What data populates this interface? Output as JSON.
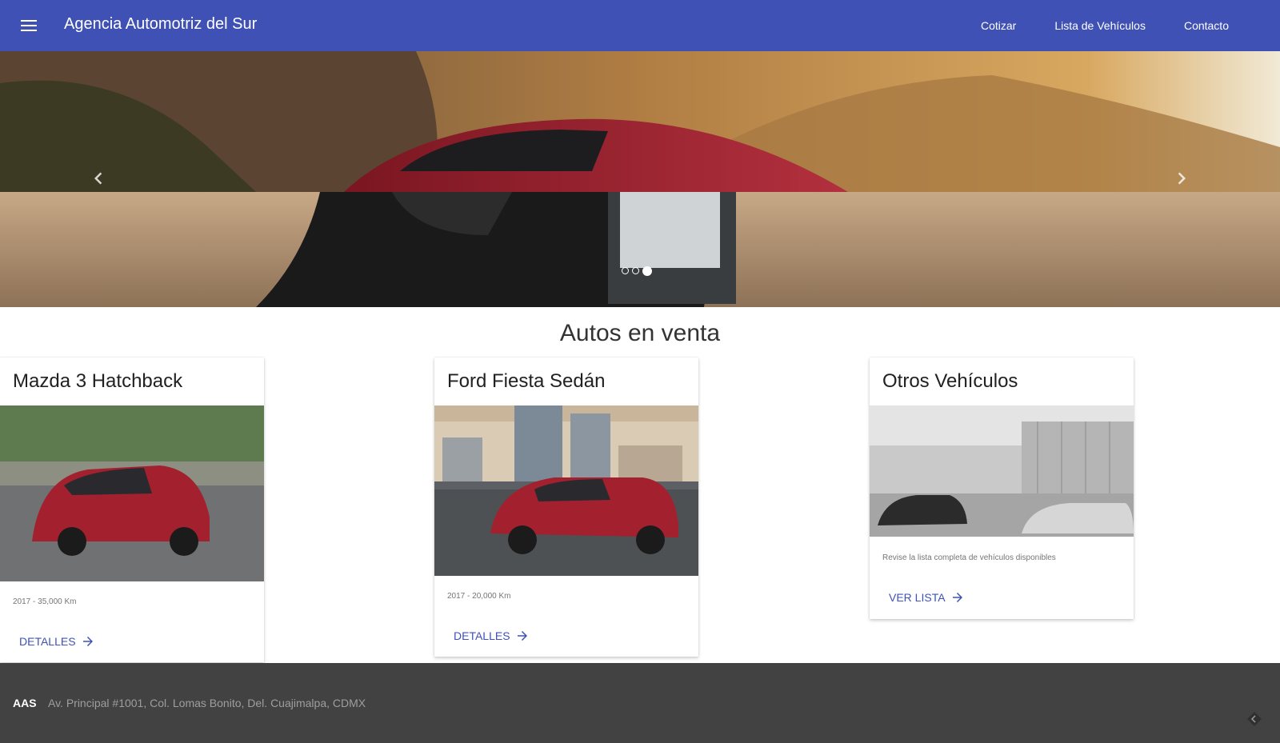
{
  "header": {
    "title": "Agencia Automotriz del Sur",
    "nav": [
      "Cotizar",
      "Lista de Vehículos",
      "Contacto"
    ]
  },
  "hero": {
    "active_slide": 3,
    "slide_count": 3
  },
  "section": {
    "title": "Autos en venta"
  },
  "cards": [
    {
      "title": "Mazda 3 Hatchback",
      "text": "2017 - 35,000 Km",
      "action": "DETALLES"
    },
    {
      "title": "Ford Fiesta Sedán",
      "text": "2017 - 20,000 Km",
      "action": "DETALLES"
    },
    {
      "title": "Otros Vehículos",
      "text": "Revise la lista completa de vehículos disponibles",
      "action": "VER LISTA"
    }
  ],
  "footer": {
    "logo": "AAS",
    "address": "Av. Principal #1001, Col. Lomas Bonito, Del. Cuajimalpa, CDMX"
  },
  "colors": {
    "primary": "#3f51b5",
    "footer": "#424242",
    "car_red": "#a3202e"
  },
  "icons": [
    "menu-icon",
    "chevron-left-icon",
    "chevron-right-icon",
    "arrow-forward-icon"
  ]
}
